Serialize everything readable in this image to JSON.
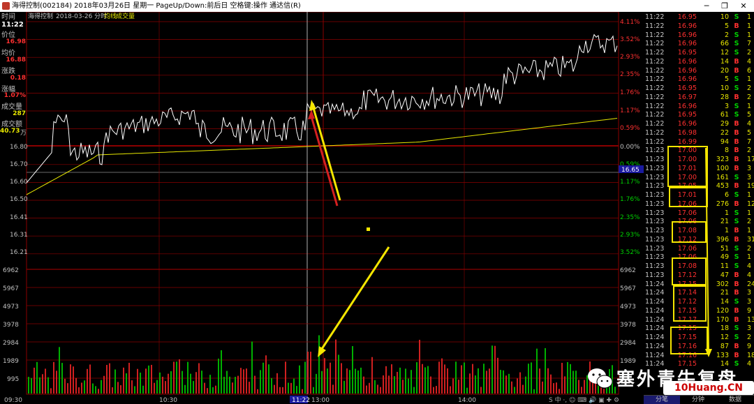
{
  "window": {
    "title": "海得控制(002184) 2018年03月26日 星期一 PageUp/Down:前后日 空格键:操作 通达信(R)",
    "min": "─",
    "max": "❐",
    "close": "✕"
  },
  "header": {
    "time_label": "时间",
    "stock_name": "海得控制",
    "date_info": "2018-03-26 分时",
    "avg_legend": "均线",
    "vol_legend": "成交量"
  },
  "side_panel": {
    "time": "11:22",
    "price_label": "价位",
    "price": "16.98",
    "avg_label": "均价",
    "avg": "16.88",
    "change_label": "涨跌",
    "change": "0.18",
    "pct_label": "涨幅",
    "pct": "1.07%",
    "vol_label": "成交量",
    "vol": "287",
    "amount_label": "成交额",
    "amount": "40.73",
    "amount_unit": "万"
  },
  "price_axis": {
    "left_labels": [
      "16.80",
      "16.70",
      "16.60",
      "16.50",
      "16.41",
      "16.31",
      "16.21"
    ],
    "right_labels": [
      "4.11%",
      "3.52%",
      "2.93%",
      "2.35%",
      "1.76%",
      "1.17%",
      "0.59%",
      "0.00%",
      "0.59%",
      "1.17%",
      "1.76%",
      "2.35%",
      "2.93%",
      "3.52%"
    ],
    "current_price_tag": "16.65"
  },
  "volume_axis": {
    "labels": [
      "6962",
      "5967",
      "4973",
      "3978",
      "2984",
      "1989",
      "995"
    ]
  },
  "time_axis": {
    "labels": [
      "09:30",
      "10:30",
      "11:22",
      "13:00",
      "14:00"
    ]
  },
  "colors": {
    "up": "#ff3030",
    "down": "#00d000",
    "box": "#f5e600",
    "grid": "#8b0000",
    "avg": "#e8e800"
  },
  "ticks": [
    [
      "11:22",
      "16.95",
      "10",
      "S",
      "1"
    ],
    [
      "11:22",
      "16.96",
      "5",
      "B",
      "1"
    ],
    [
      "11:22",
      "16.96",
      "2",
      "S",
      "1"
    ],
    [
      "11:22",
      "16.96",
      "66",
      "S",
      "7"
    ],
    [
      "11:22",
      "16.95",
      "12",
      "S",
      "2"
    ],
    [
      "11:22",
      "16.96",
      "14",
      "B",
      "4"
    ],
    [
      "11:22",
      "16.96",
      "20",
      "B",
      "6"
    ],
    [
      "11:22",
      "16.96",
      "5",
      "S",
      "1"
    ],
    [
      "11:22",
      "16.95",
      "10",
      "S",
      "2"
    ],
    [
      "11:22",
      "16.97",
      "28",
      "B",
      "2"
    ],
    [
      "11:22",
      "16.96",
      "3",
      "S",
      "1"
    ],
    [
      "11:22",
      "16.95",
      "61",
      "S",
      "5"
    ],
    [
      "11:22",
      "16.96",
      "29",
      "B",
      "4"
    ],
    [
      "11:22",
      "16.98",
      "22",
      "B",
      "5"
    ],
    [
      "11:22",
      "16.99",
      "94",
      "B",
      "7"
    ],
    [
      "11:23",
      "17.00",
      "8",
      "B",
      "2"
    ],
    [
      "11:23",
      "17.00",
      "323",
      "B",
      "17"
    ],
    [
      "11:23",
      "17.01",
      "100",
      "B",
      "3"
    ],
    [
      "11:23",
      "17.00",
      "161",
      "S",
      "3"
    ],
    [
      "11:23",
      "17.05",
      "453",
      "B",
      "19"
    ],
    [
      "11:23",
      "17.01",
      "6",
      "S",
      "1"
    ],
    [
      "11:23",
      "17.06",
      "276",
      "B",
      "12"
    ],
    [
      "11:23",
      "17.06",
      "1",
      "S",
      "1"
    ],
    [
      "11:23",
      "17.06",
      "21",
      "S",
      "2"
    ],
    [
      "11:23",
      "17.08",
      "1",
      "B",
      "1"
    ],
    [
      "11:23",
      "17.12",
      "396",
      "B",
      "31"
    ],
    [
      "11:23",
      "17.06",
      "51",
      "S",
      "2"
    ],
    [
      "11:23",
      "17.06",
      "49",
      "S",
      "1"
    ],
    [
      "11:23",
      "17.08",
      "11",
      "S",
      "4"
    ],
    [
      "11:23",
      "17.12",
      "47",
      "B",
      "4"
    ],
    [
      "11:24",
      "17.15",
      "302",
      "B",
      "24"
    ],
    [
      "11:24",
      "17.14",
      "21",
      "B",
      "3"
    ],
    [
      "11:24",
      "17.12",
      "14",
      "S",
      "3"
    ],
    [
      "11:24",
      "17.15",
      "120",
      "B",
      "9"
    ],
    [
      "11:24",
      "17.17",
      "170",
      "B",
      "13"
    ],
    [
      "11:24",
      "17.15",
      "18",
      "S",
      "3"
    ],
    [
      "11:24",
      "17.15",
      "12",
      "S",
      "2"
    ],
    [
      "11:24",
      "17.16",
      "87",
      "B",
      "9"
    ],
    [
      "11:24",
      "17.16",
      "133",
      "B",
      "18"
    ],
    [
      "11:24",
      "17.15",
      "14",
      "S",
      "4"
    ]
  ],
  "tick_tabs": {
    "fenbi": "分笔",
    "fenzhong": "分钟",
    "shuju": "数据"
  },
  "watermark": {
    "text": "塞外青牛复盘",
    "logo": "10Huang.CN"
  },
  "tray": "S 中 ·, ☺ ⌨ 🔊 ▣ ✚ ⚙"
}
